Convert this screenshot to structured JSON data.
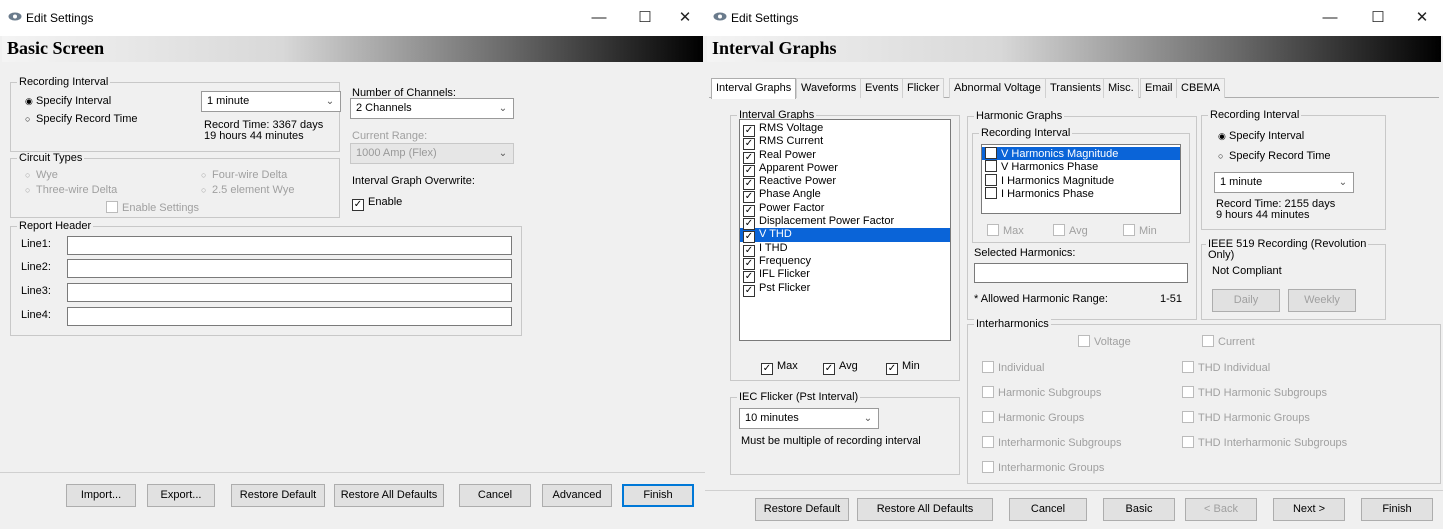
{
  "win1": {
    "title": "Edit Settings",
    "minimize": "—",
    "maximize": "☐",
    "close": "✕",
    "banner": "Basic Screen",
    "recording_interval": {
      "legend": "Recording Interval",
      "specify_interval": "Specify Interval",
      "specify_record_time": "Specify Record Time",
      "interval_value": "1 minute",
      "record_time_line1": "Record Time: 3367 days",
      "record_time_line2": "19 hours 44 minutes"
    },
    "channels": {
      "label": "Number of Channels:",
      "value": "2 Channels",
      "current_range_label": "Current Range:",
      "current_range_value": "1000 Amp (Flex)",
      "overwrite_label": "Interval Graph Overwrite:",
      "enable_label": "Enable"
    },
    "circuit_types": {
      "legend": "Circuit Types",
      "wye": "Wye",
      "four_wire_delta": "Four-wire Delta",
      "three_wire_delta": "Three-wire Delta",
      "element_wye": "2.5 element Wye",
      "enable_settings": "Enable Settings"
    },
    "report_header": {
      "legend": "Report Header",
      "lines": [
        "Line1:",
        "Line2:",
        "Line3:",
        "Line4:"
      ]
    },
    "buttons": {
      "import": "Import...",
      "export": "Export...",
      "restore_default": "Restore Default",
      "restore_all": "Restore All Defaults",
      "cancel": "Cancel",
      "advanced": "Advanced",
      "finish": "Finish"
    }
  },
  "win2": {
    "title": "Edit Settings",
    "minimize": "—",
    "maximize": "☐",
    "close": "✕",
    "banner": "Interval Graphs",
    "tabs": [
      "Interval Graphs",
      "Waveforms",
      "Events",
      "Flicker",
      "Abnormal Voltage",
      "Transients",
      "Misc.",
      "Email",
      "CBEMA"
    ],
    "interval_graphs": {
      "legend": "Interval Graphs",
      "items": [
        "RMS Voltage",
        "RMS Current",
        "Real Power",
        "Apparent Power",
        "Reactive Power",
        "Phase Angle",
        "Power Factor",
        "Displacement Power Factor",
        "V THD",
        "I THD",
        "Frequency",
        "IFL Flicker",
        "Pst Flicker"
      ],
      "selected": "V THD",
      "max": "Max",
      "avg": "Avg",
      "min": "Min"
    },
    "iec_flicker": {
      "legend": "IEC Flicker (Pst Interval)",
      "value": "10 minutes",
      "note": "Must be multiple of recording interval"
    },
    "harmonic_graphs": {
      "legend": "Harmonic Graphs",
      "sub_legend": "Recording Interval",
      "items": [
        "V Harmonics Magnitude",
        "V Harmonics Phase",
        "I Harmonics Magnitude",
        "I Harmonics Phase"
      ],
      "max": "Max",
      "avg": "Avg",
      "min": "Min",
      "selected_label": "Selected Harmonics:",
      "allowed_label": "* Allowed Harmonic Range:",
      "allowed_value": "1-51"
    },
    "recording_interval": {
      "legend": "Recording Interval",
      "specify_interval": "Specify Interval",
      "specify_record_time": "Specify Record Time",
      "value": "1 minute",
      "record_time_line1": "Record Time: 2155 days",
      "record_time_line2": "9 hours 44 minutes"
    },
    "ieee": {
      "legend_line1": "IEEE 519 Recording (Revolution",
      "legend_line2": "Only)",
      "status": "Not Compliant",
      "daily": "Daily",
      "weekly": "Weekly"
    },
    "interharmonics": {
      "legend": "Interharmonics",
      "voltage": "Voltage",
      "current": "Current",
      "left": [
        "Individual",
        "Harmonic Subgroups",
        "Harmonic Groups",
        "Interharmonic Subgroups",
        "Interharmonic Groups"
      ],
      "right": [
        "THD Individual",
        "THD Harmonic Subgroups",
        "THD Harmonic Groups",
        "THD Interharmonic Subgroups"
      ]
    },
    "buttons": {
      "restore_default": "Restore Default",
      "restore_all": "Restore All Defaults",
      "cancel": "Cancel",
      "basic": "Basic",
      "back": "< Back",
      "next": "Next >",
      "finish": "Finish"
    }
  }
}
